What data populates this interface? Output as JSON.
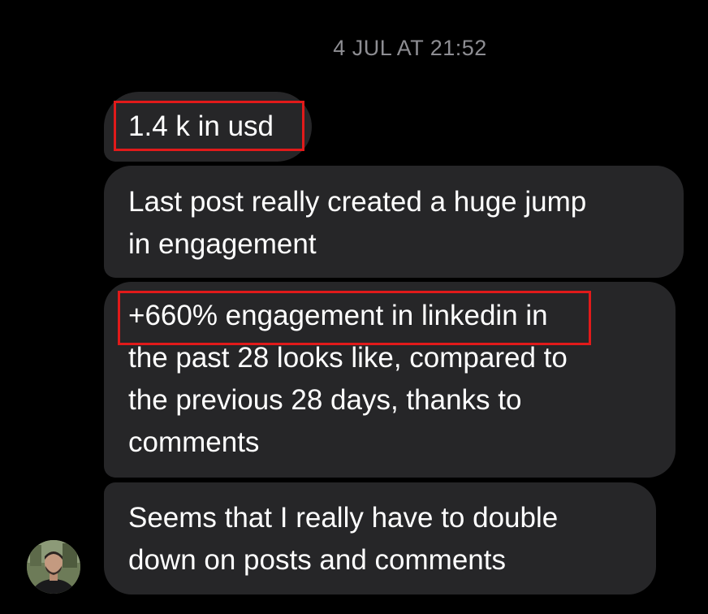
{
  "header": {
    "timestamp": "4 JUL AT 21:52"
  },
  "messages": [
    {
      "lines": [
        "1.4 k in usd"
      ]
    },
    {
      "lines": [
        "Last post really created a huge jump",
        "in engagement"
      ]
    },
    {
      "lines": [
        "+660% engagement in linkedin in",
        "the past 28 looks like, compared to",
        "the previous 28 days, thanks to",
        "comments"
      ]
    },
    {
      "lines": [
        "Seems that I really have to double",
        "down on posts and comments"
      ]
    }
  ],
  "colors": {
    "background": "#000000",
    "bubble": "#262628",
    "timestamp": "#8e8e93",
    "highlight": "#e11a1a"
  },
  "icons": {
    "avatar": "sender-avatar-photo"
  }
}
